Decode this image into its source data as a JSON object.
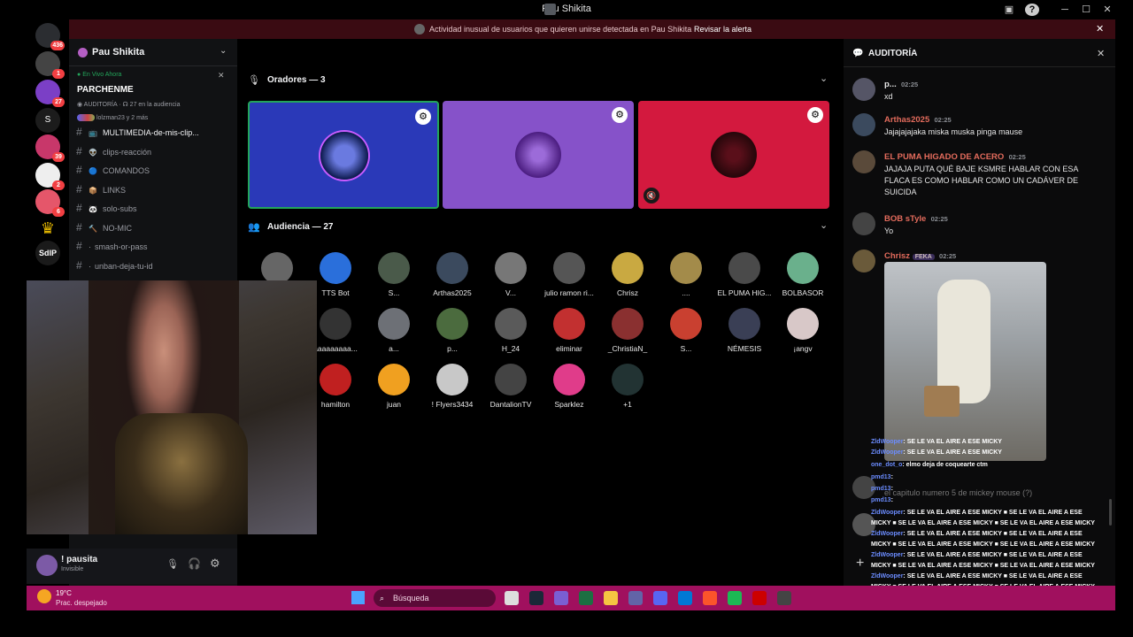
{
  "window": {
    "title": "Pau Shikita",
    "minimize": "─",
    "maximize": "☐",
    "close": "✕",
    "inbox_icon": "inbox-icon",
    "help": "?"
  },
  "alert": {
    "text": "Actividad inusual de usuarios que quieren unirse detectada en Pau Shikita",
    "link": "Revisar la alerta",
    "close": "✕"
  },
  "rail": {
    "badges": [
      "436",
      "1",
      "27",
      "39",
      "2",
      "6"
    ],
    "srv_s": "S",
    "srv_sdip": "SdIP"
  },
  "server": {
    "name": "Pau Shikita",
    "live_label": "En Vivo Ahora",
    "stage_name": "PARCHENME",
    "stage_sub": "AUDITORÍA",
    "audience_count": "27 en la audiencia",
    "speakers_line": "lolzman23 y 2 más",
    "channels": [
      {
        "name": "MULTIMEDIA-de-mis-clip...",
        "emoji": "📺"
      },
      {
        "name": "clips-reacción",
        "emoji": "👽"
      },
      {
        "name": "COMANDOS",
        "emoji": "🔵"
      },
      {
        "name": "LINKS",
        "emoji": "📦"
      },
      {
        "name": "solo-subs",
        "emoji": "🐼"
      },
      {
        "name": "NO-MIC",
        "emoji": "🔨"
      },
      {
        "name": "smash-or-pass",
        "emoji": ""
      },
      {
        "name": "unban-deja-tu-id",
        "emoji": ""
      }
    ]
  },
  "stage": {
    "speakers_title": "Oradores — 3",
    "audience_title": "Audiencia — 27",
    "audience": [
      {
        "name": ""
      },
      {
        "name": "TTS Bot"
      },
      {
        "name": "S..."
      },
      {
        "name": "Arthas2025"
      },
      {
        "name": "V..."
      },
      {
        "name": "julio ramon ri..."
      },
      {
        "name": "Chrisz"
      },
      {
        "name": "...."
      },
      {
        "name": "EL PUMA HIG..."
      },
      {
        "name": "BOLBASOR"
      },
      {
        "name": ""
      },
      {
        "name": "aaaaaaaaa..."
      },
      {
        "name": "a..."
      },
      {
        "name": "p..."
      },
      {
        "name": "H_24"
      },
      {
        "name": "eliminar"
      },
      {
        "name": "_ChristiaN_"
      },
      {
        "name": "S..."
      },
      {
        "name": "NÉMESIS"
      },
      {
        "name": "¡angv"
      },
      {
        "name": ""
      },
      {
        "name": "hamilton"
      },
      {
        "name": "juan"
      },
      {
        "name": "! Flyers3434"
      },
      {
        "name": "DantalionTV"
      },
      {
        "name": "Sparklez"
      },
      {
        "name": "+1"
      }
    ]
  },
  "chat": {
    "title": "AUDITORÍA",
    "close": "✕",
    "messages": [
      {
        "name": "p...",
        "time": "02:25",
        "text": "xd",
        "color": "#e8e8e8"
      },
      {
        "name": "Arthas2025",
        "time": "02:25",
        "text": "Jajajajajaka miska muska pinga mause",
        "color": "#e36b5c"
      },
      {
        "name": "EL PUMA HIGADO DE ACERO",
        "time": "02:25",
        "text": "JAJAJA PUTA QUÉ BAJE KSMRE HABLAR CON ESA FLACA ES COMO HABLAR COMO UN CADÁVER DE SUICIDA",
        "color": "#e36b5c"
      },
      {
        "name": "BOB sTyle",
        "time": "02:25",
        "text": "Yo",
        "color": "#e36b5c"
      },
      {
        "name": "Chrisz",
        "time": "02:25",
        "tag": "FEKA",
        "text": "",
        "color": "#e36b5c"
      }
    ],
    "faded": "el capitulo numero 5 de mickey mouse (?)",
    "faded_time": "02:25"
  },
  "overlay": [
    {
      "user": "ZldWooper",
      "text": ": SE LE VA EL AIRE A ESE MICKY"
    },
    {
      "user": "ZldWooper",
      "text": ": SE LE VA EL AIRE A ESE MICKY"
    },
    {
      "user": "one_dot_o",
      "text": ": elmo deja de coquearte ctm"
    },
    {
      "user": "pmd13",
      "text": ":"
    },
    {
      "user": "pmd13",
      "text": ":"
    },
    {
      "user": "pmd13",
      "text": ":"
    },
    {
      "user": "ZldWooper",
      "text": ": SE LE VA EL AIRE A ESE MICKY ■ SE LE VA EL AIRE A ESE"
    },
    {
      "user": "",
      "text": "MICKY ■ SE LE VA EL AIRE A ESE MICKY ■ SE LE VA EL AIRE A ESE MICKY"
    },
    {
      "user": "ZldWooper",
      "text": ": SE LE VA EL AIRE A ESE MICKY ■ SE LE VA EL AIRE A ESE"
    },
    {
      "user": "",
      "text": "MICKY ■ SE LE VA EL AIRE A ESE MICKY ■ SE LE VA EL AIRE A ESE MICKY"
    },
    {
      "user": "ZldWooper",
      "text": ": SE LE VA EL AIRE A ESE MICKY ■ SE LE VA EL AIRE A ESE"
    },
    {
      "user": "",
      "text": "MICKY ■ SE LE VA EL AIRE A ESE MICKY ■ SE LE VA EL AIRE A ESE MICKY"
    },
    {
      "user": "ZldWooper",
      "text": ": SE LE VA EL AIRE A ESE MICKY ■ SE LE VA EL AIRE A ESE"
    },
    {
      "user": "",
      "text": "MICKY ■ SE LE VA EL AIRE A ESE MICKY ■ SE LE VA EL AIRE A ESE MICKY"
    },
    {
      "user": "ZldWooper",
      "text": ": SE LE VA EL AIRE A ESE MICKY ■ SE LE VA EL AIRE A ESE"
    },
    {
      "user": "",
      "text": "MICKY ■ SE LE VA EL AIRE A ESE MICKY ■ SE LE VA EL AIRE A ESE MICKY"
    }
  ],
  "user": {
    "name": "! pausita",
    "status": "Invisible"
  },
  "taskbar": {
    "temp": "19°C",
    "weather": "Prac. despejado",
    "search": "Búsqueda"
  },
  "colors": {
    "blurple": "#2a39b8",
    "purple": "#8652c9",
    "red": "#d3193e",
    "taskbar": "#a0105e"
  }
}
